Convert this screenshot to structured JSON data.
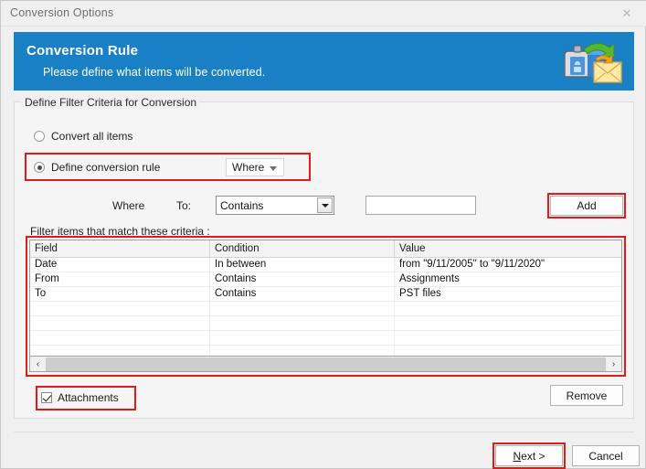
{
  "window": {
    "title": "Conversion Options",
    "close_icon": "close-icon",
    "close_glyph": "✕"
  },
  "banner": {
    "title": "Conversion Rule",
    "subtitle": "Please define what items will be converted.",
    "icon": "mailbox-convert-icon",
    "background_color": "#1a80c6",
    "text_color": "#ffffff"
  },
  "groupbox": {
    "label": "Define Filter Criteria for Conversion"
  },
  "options": {
    "convert_all": {
      "label": "Convert all items",
      "selected": false
    },
    "define_rule": {
      "label": "Define conversion rule",
      "selected": true
    },
    "scope_combo": {
      "value": "Where",
      "caret_icon": "chevron-down-icon"
    }
  },
  "criteria_builder": {
    "where_label": "Where",
    "to_label": "To:",
    "condition_combo": {
      "value": "Contains",
      "caret_icon": "chevron-down-icon"
    },
    "value_input": {
      "value": "",
      "placeholder": ""
    },
    "add_button": "Add"
  },
  "criteria_list": {
    "caption": "Filter items that match these criteria :",
    "columns": [
      "Field",
      "Condition",
      "Value"
    ],
    "rows": [
      {
        "field": "Date",
        "condition": "In between",
        "value": "from    \"9/11/2005\"   to   \"9/11/2020\""
      },
      {
        "field": "From",
        "condition": "Contains",
        "value": "Assignments"
      },
      {
        "field": "To",
        "condition": "Contains",
        "value": "PST files"
      }
    ],
    "scrollbar": {
      "left_arrow_icon": "chevron-left-icon",
      "left_arrow_glyph": "‹",
      "right_arrow_icon": "chevron-right-icon",
      "right_arrow_glyph": "›"
    }
  },
  "attachments": {
    "label": "Attachments",
    "checked": true
  },
  "buttons": {
    "remove": "Remove",
    "next": "Next >",
    "next_mnemonic": "N",
    "cancel": "Cancel"
  },
  "annotations": {
    "color": "#e01b19",
    "targets": [
      "define-conversion-rule-row",
      "add-button",
      "criteria-list",
      "attachments-checkbox",
      "next-button"
    ]
  }
}
